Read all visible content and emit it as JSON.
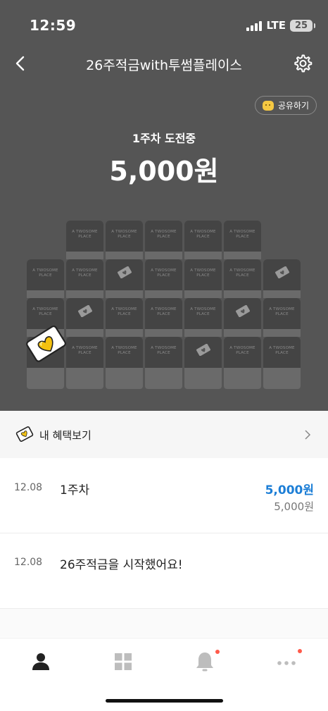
{
  "status_bar": {
    "time": "12:59",
    "network": "LTE",
    "battery": "25"
  },
  "header": {
    "title": "26주적금with투썸플레이스",
    "share_label": "공유하기"
  },
  "challenge": {
    "week_status": "1주차 도전중",
    "amount": "5,000원"
  },
  "grid": {
    "brand_line1": "A TWOSOME",
    "brand_line2": "PLACE"
  },
  "benefits": {
    "label": "내 혜택보기"
  },
  "history": [
    {
      "date": "12.08",
      "text": "1주차",
      "amount": "5,000원",
      "balance": "5,000원"
    },
    {
      "date": "12.08",
      "text": "26주적금을 시작했어요!"
    }
  ],
  "tabbar": {
    "tabs": [
      "profile-icon",
      "grid-icon",
      "bell-icon",
      "more-icon"
    ]
  },
  "colors": {
    "header_bg": "#555555",
    "accent": "#1c7ed6",
    "badge": "#ff5a4a"
  }
}
